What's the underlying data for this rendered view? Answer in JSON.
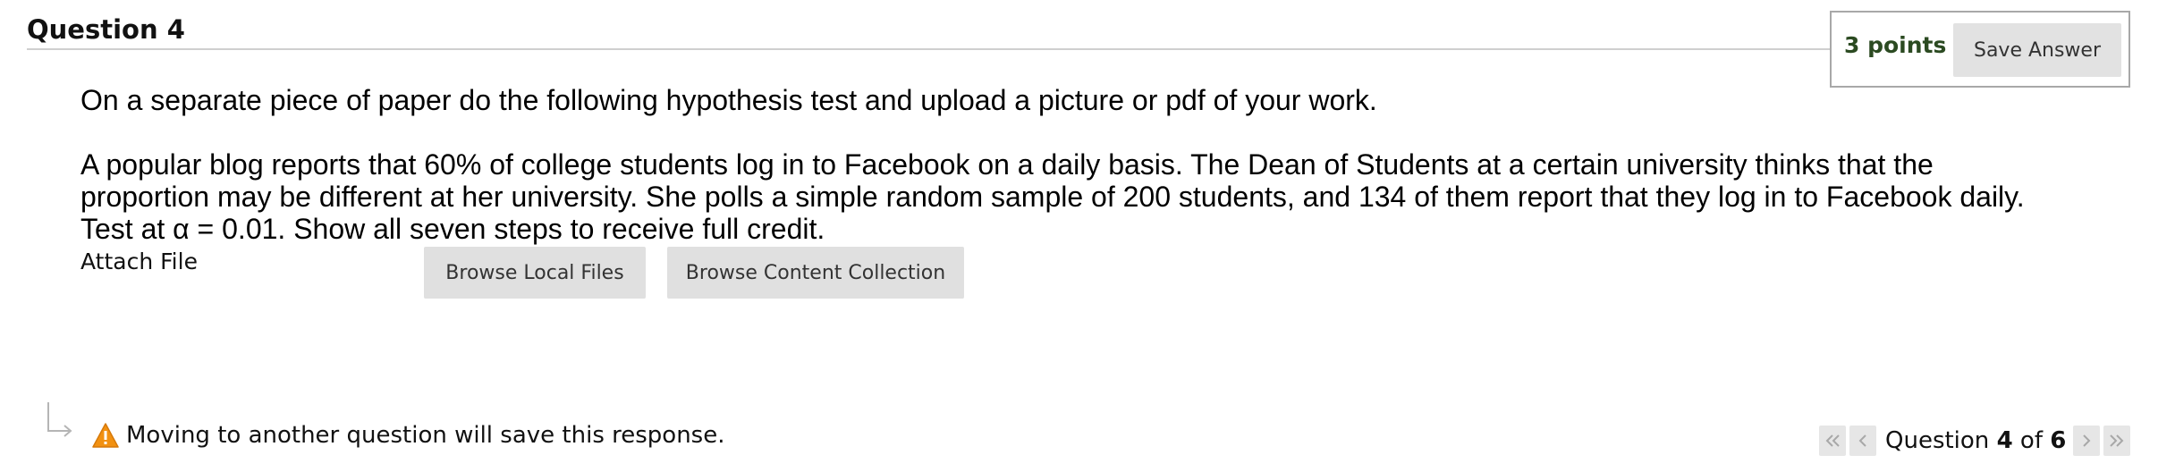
{
  "question": {
    "title": "Question 4",
    "points_label": "3 points",
    "save_label": "Save Answer",
    "instruction": "On a separate piece of paper do the following hypothesis test and upload a picture or pdf of your work.",
    "prompt_lines": [
      "A popular blog reports that 60% of college students log in to Facebook on a daily basis.  The Dean of Students at a certain university thinks that the",
      "proportion may be different at her university.  She polls a simple random sample of 200 students, and 134 of them report that they log in to Facebook daily.",
      "Test at α = 0.01.  Show all seven steps to receive full credit."
    ]
  },
  "attach": {
    "label": "Attach File",
    "browse_local": "Browse Local Files",
    "browse_collection": "Browse Content Collection"
  },
  "footer": {
    "warning": "Moving to another question will save this response."
  },
  "nav": {
    "prefix": "Question",
    "current": "4",
    "separator": "of",
    "total": "6"
  },
  "colors": {
    "points": "#2b4a21",
    "button_bg": "#e0e0e0",
    "warning_orange": "#f29111"
  },
  "icons": [
    "return-arrow-icon",
    "warning-icon",
    "first-page-icon",
    "previous-icon",
    "next-icon",
    "last-page-icon"
  ]
}
